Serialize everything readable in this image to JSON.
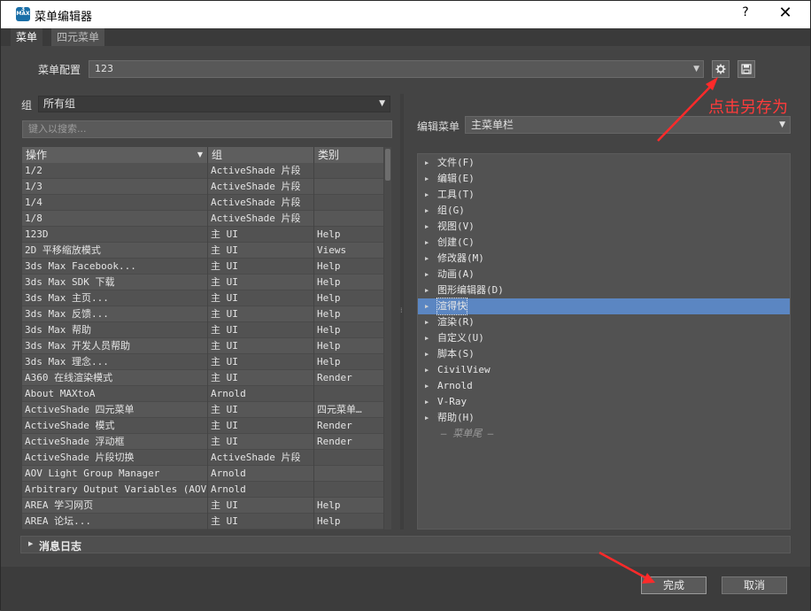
{
  "window": {
    "icon_text": "3",
    "icon_sub": "MAX",
    "title": "菜单编辑器",
    "help_label": "?",
    "close_label": "✕"
  },
  "tabs": [
    {
      "label": "菜单",
      "active": true
    },
    {
      "label": "四元菜单",
      "active": false
    }
  ],
  "config": {
    "label": "菜单配置",
    "value": "123",
    "gear_icon": "gear-icon",
    "save_icon": "floppy-disk-icon"
  },
  "annotation": {
    "text": "点击另存为",
    "color": "#ff3b3b"
  },
  "left": {
    "group_label": "组",
    "group_value": "所有组",
    "search_placeholder": "键入以搜索...",
    "columns": [
      "操作",
      "组",
      "类别"
    ],
    "rows": [
      [
        "1/2",
        "ActiveShade 片段",
        ""
      ],
      [
        "1/3",
        "ActiveShade 片段",
        ""
      ],
      [
        "1/4",
        "ActiveShade 片段",
        ""
      ],
      [
        "1/8",
        "ActiveShade 片段",
        ""
      ],
      [
        "123D",
        "主 UI",
        "Help"
      ],
      [
        "2D 平移缩放模式",
        "主 UI",
        "Views"
      ],
      [
        "3ds Max Facebook...",
        "主 UI",
        "Help"
      ],
      [
        "3ds Max SDK 下载",
        "主 UI",
        "Help"
      ],
      [
        "3ds Max 主页...",
        "主 UI",
        "Help"
      ],
      [
        "3ds Max 反馈...",
        "主 UI",
        "Help"
      ],
      [
        "3ds Max 帮助",
        "主 UI",
        "Help"
      ],
      [
        "3ds Max 开发人员帮助",
        "主 UI",
        "Help"
      ],
      [
        "3ds Max 理念...",
        "主 UI",
        "Help"
      ],
      [
        "A360 在线渲染模式",
        "主 UI",
        "Render"
      ],
      [
        "About MAXtoA",
        "Arnold",
        ""
      ],
      [
        "ActiveShade 四元菜单",
        "主 UI",
        "四元菜单…"
      ],
      [
        "ActiveShade 模式",
        "主 UI",
        "Render"
      ],
      [
        "ActiveShade 浮动框",
        "主 UI",
        "Render"
      ],
      [
        "ActiveShade 片段切换",
        "ActiveShade 片段",
        ""
      ],
      [
        "AOV Light Group Manager",
        "Arnold",
        ""
      ],
      [
        "Arbitrary Output Variables (AOVs)",
        "Arnold",
        ""
      ],
      [
        "AREA 学习网页",
        "主 UI",
        "Help"
      ],
      [
        "AREA 论坛...",
        "主 UI",
        "Help"
      ]
    ]
  },
  "right": {
    "edit_label": "编辑菜单",
    "edit_value": "主菜单栏",
    "items": [
      {
        "label": "文件(F)"
      },
      {
        "label": "编辑(E)"
      },
      {
        "label": "工具(T)"
      },
      {
        "label": "组(G)"
      },
      {
        "label": "视图(V)"
      },
      {
        "label": "创建(C)"
      },
      {
        "label": "修改器(M)"
      },
      {
        "label": "动画(A)"
      },
      {
        "label": "图形编辑器(D)"
      },
      {
        "label": "渲得快",
        "selected": true
      },
      {
        "label": "渲染(R)"
      },
      {
        "label": "自定义(U)"
      },
      {
        "label": "脚本(S)"
      },
      {
        "label": "CivilView"
      },
      {
        "label": "Arnold"
      },
      {
        "label": "V-Ray"
      },
      {
        "label": "帮助(H)"
      }
    ],
    "menu_end": "— 菜单尾 —"
  },
  "log": {
    "label": "消息日志"
  },
  "buttons": {
    "done": "完成",
    "cancel": "取消"
  }
}
